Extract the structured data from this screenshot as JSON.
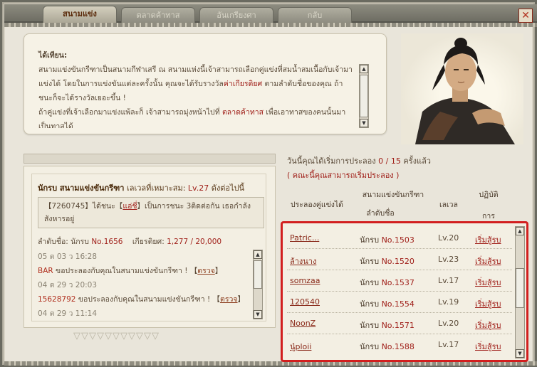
{
  "tabs": [
    {
      "label": "สนามแข่ง",
      "active": true
    },
    {
      "label": "ตลาดค้าทาส",
      "active": false
    },
    {
      "label": "อันเกรียงศา",
      "active": false
    },
    {
      "label": "กลับ",
      "active": false
    }
  ],
  "close_label": "✕",
  "intro": {
    "title": "ได้เทียน:",
    "p1_a": "สนามแข่งขันกรีฑาเป็นสนามกีฬาเสรี ณ สนามแห่งนี้เจ้าสามารถเลือกคู่แข่งที่สมน้ำสมเนื้อกับเจ้ามาแข่งได้ โดยในการแข่งขันแต่ละครั้งนั้น คุณจะได้รับรางวัล",
    "p1_hl": "ค่าเกียรติยศ",
    "p1_b": " ตามลำดับชื่อของคุณ ถ้าชนะก็จะได้รางวัลเยอะขึ้น !",
    "p2_a": "ถ้าคู่แข่งที่เจ้าเลือกมาแข่งแพ้ละก็ เจ้าสามารถมุ่งหน้าไปที่ ",
    "p2_hl": "ตลาดค้าทาส",
    "p2_b": " เพื่อเอาทาสของคนนั้นมาเป็นทาสได้"
  },
  "ranking": {
    "title_bold": "นักรบ สนามแข่งขันกรีฑา",
    "level_hint": " เลเวลที่เหมาะสม: ",
    "level_value": "Lv.27",
    "level_tail": " ดังต่อไปนี้",
    "msg_id": "【7260745】",
    "msg_mid": "ได้ชนะ【",
    "msg_name": "แอ่ชี่",
    "msg_tail": "】เป็นการชนะ 3ติดต่อกัน เธอกำลังสังหารอยู่",
    "rank_label": "ลำดับชื่อ: นักรบ ",
    "rank_no": "No.1656",
    "honor_label": "เกียรติยศ: ",
    "honor_value": "1,277 / 20,000",
    "log": [
      {
        "time": "05 ต 03 ว 16:28"
      },
      {
        "who": "BAR",
        "text": " ขอประลองกับคุณในสนามแข่งขันกรีฑา ! ",
        "link": "ตรวจ"
      },
      {
        "time": "04 ต 29 ว 20:03"
      },
      {
        "who": "15628792",
        "text": " ขอประลองกับคุณในสนามแข่งขันกรีฑา ! ",
        "link": "ตรวจ"
      },
      {
        "time": "04 ต 29 ว 11:14"
      }
    ]
  },
  "today": {
    "prefix": "วันนี้คุณได้เริ่มการประลอง ",
    "used": "0 / 15",
    "suffix": " ครั้งแล้ว",
    "note": "( คณะนี้คุณสามารถเริ่มประลอง )"
  },
  "columns": {
    "opponent": "ประลองคู่แข่งได้",
    "rank_line1": "สนามแข่งขันกรีฑา",
    "rank_line2": "ลำดับชื่อ",
    "level": "เลเวล",
    "action_line1": "ปฏิบัติ",
    "action_line2": "การ"
  },
  "opponents": [
    {
      "name": "Patric...",
      "rank_prefix": "นักรบ ",
      "rank": "No.1503",
      "level": "Lv.20",
      "action": "เริ่มสู้รบ"
    },
    {
      "name": "ล้างนาง",
      "rank_prefix": "นักรบ ",
      "rank": "No.1520",
      "level": "Lv.23",
      "action": "เริ่มสู้รบ"
    },
    {
      "name": "somzaa",
      "rank_prefix": "นักรบ ",
      "rank": "No.1537",
      "level": "Lv.17",
      "action": "เริ่มสู้รบ"
    },
    {
      "name": "120540",
      "rank_prefix": "นักรบ ",
      "rank": "No.1554",
      "level": "Lv.19",
      "action": "เริ่มสู้รบ"
    },
    {
      "name": "NoonZ",
      "rank_prefix": "นักรบ ",
      "rank": "No.1571",
      "level": "Lv.20",
      "action": "เริ่มสู้รบ"
    },
    {
      "name": "นู๋ploii",
      "rank_prefix": "นักรบ ",
      "rank": "No.1588",
      "level": "Lv.17",
      "action": "เริ่มสู้รบ"
    }
  ],
  "colors": {
    "accent_red": "#d21f1f",
    "link_red": "#a0201a",
    "panel": "#f3efe3"
  }
}
